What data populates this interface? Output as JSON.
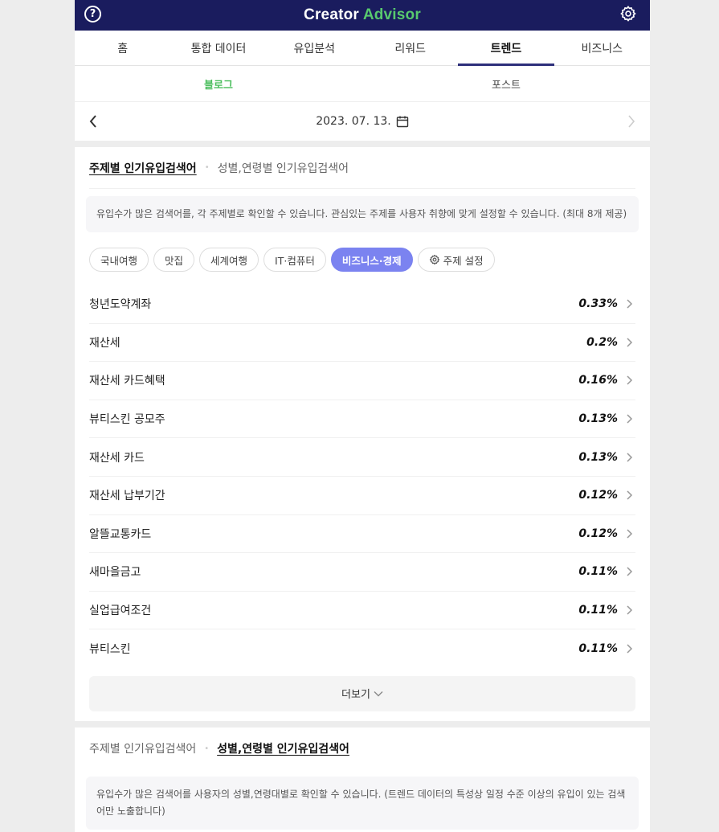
{
  "header": {
    "logo_main": "Creator",
    "logo_accent": "Advisor",
    "accent_color": "#58c96e",
    "bg_color": "#1a1c5e"
  },
  "tabs": [
    {
      "label": "홈"
    },
    {
      "label": "통합 데이터"
    },
    {
      "label": "유입분석"
    },
    {
      "label": "리워드"
    },
    {
      "label": "트렌드",
      "active": true
    },
    {
      "label": "비즈니스"
    }
  ],
  "subtabs": [
    {
      "label": "블로그",
      "active": true
    },
    {
      "label": "포스트"
    }
  ],
  "date": {
    "value": "2023. 07. 13."
  },
  "section1": {
    "title_active": "주제별 인기유입검색어",
    "title_other": "성별,연령별 인기유입검색어",
    "info": "유입수가 많은 검색어를, 각 주제별로 확인할 수 있습니다. 관심있는 주제를 사용자 취향에 맞게 설정할 수 있습니다. (최대 8개 제공)",
    "chips": [
      {
        "label": "국내여행"
      },
      {
        "label": "맛집"
      },
      {
        "label": "세계여행"
      },
      {
        "label": "IT·컴퓨터"
      },
      {
        "label": "비즈니스·경제",
        "active": true
      }
    ],
    "settings_chip": "주제 설정",
    "keywords": [
      {
        "keyword": "청년도약계좌",
        "pct": "0.33%"
      },
      {
        "keyword": "재산세",
        "pct": "0.2%"
      },
      {
        "keyword": "재산세 카드혜택",
        "pct": "0.16%"
      },
      {
        "keyword": "뷰티스킨 공모주",
        "pct": "0.13%"
      },
      {
        "keyword": "재산세 카드",
        "pct": "0.13%"
      },
      {
        "keyword": "재산세 납부기간",
        "pct": "0.12%"
      },
      {
        "keyword": "알뜰교통카드",
        "pct": "0.12%"
      },
      {
        "keyword": "새마을금고",
        "pct": "0.11%"
      },
      {
        "keyword": "실업급여조건",
        "pct": "0.11%"
      },
      {
        "keyword": "뷰티스킨",
        "pct": "0.11%"
      }
    ],
    "more_label": "더보기"
  },
  "section2": {
    "title_other": "주제별 인기유입검색어",
    "title_active": "성별,연령별 인기유입검색어",
    "info": "유입수가 많은 검색어를 사용자의 성별,연령대별로 확인할 수 있습니다. (트렌드 데이터의 특성상 일정 수준 이상의 유입이 있는 검색어만 노출합니다)"
  }
}
